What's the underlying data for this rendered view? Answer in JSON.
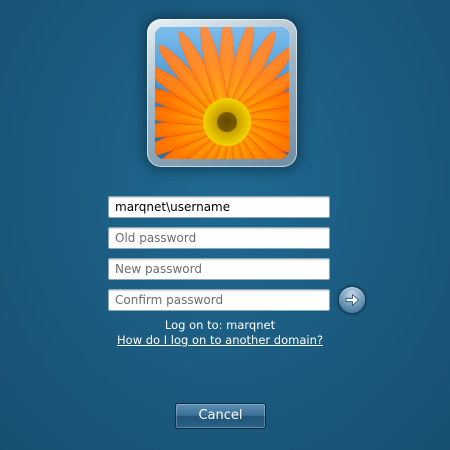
{
  "avatar": {
    "icon": "orange-gerbera-flower-avatar"
  },
  "fields": {
    "username": {
      "value": "marqnet\\username"
    },
    "old_password": {
      "placeholder": "Old password"
    },
    "new_password": {
      "placeholder": "New password"
    },
    "confirm_password": {
      "placeholder": "Confirm password"
    }
  },
  "submit": {
    "icon": "arrow-right-icon"
  },
  "logon": {
    "text": "Log on to: marqnet",
    "domain_link": "How do I log on to another domain?"
  },
  "cancel": {
    "label": "Cancel"
  },
  "colors": {
    "background": "#1b5a7e",
    "button": "#2a6288",
    "text": "#ffffff"
  }
}
